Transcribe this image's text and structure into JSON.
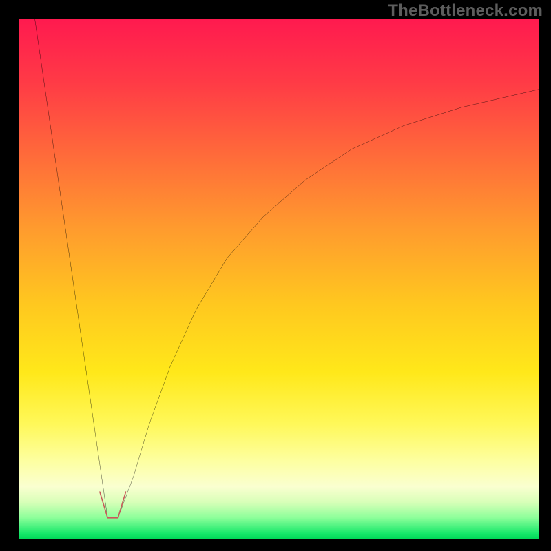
{
  "watermark": "TheBottleneck.com",
  "chart_data": {
    "type": "line",
    "title": "",
    "xlabel": "",
    "ylabel": "",
    "xlim": [
      0,
      100
    ],
    "ylim": [
      0,
      100
    ],
    "grid": false,
    "legend": false,
    "series": [
      {
        "name": "left-branch",
        "x": [
          3,
          17
        ],
        "values": [
          100,
          4
        ]
      },
      {
        "name": "right-branch",
        "x": [
          19,
          22,
          25,
          29,
          34,
          40,
          47,
          55,
          64,
          74,
          85,
          100
        ],
        "values": [
          4,
          12,
          22,
          33,
          44,
          54,
          62,
          69,
          75,
          79.5,
          83,
          86.5
        ]
      },
      {
        "name": "highlight-elbow",
        "x": [
          15.5,
          17,
          19,
          20.5
        ],
        "values": [
          9,
          4,
          4,
          9
        ]
      }
    ],
    "colors": {
      "main_curve": "#000000",
      "highlight": "#c85a5a",
      "gradient_top": "#ff1a4f",
      "gradient_bottom": "#00d858"
    }
  }
}
